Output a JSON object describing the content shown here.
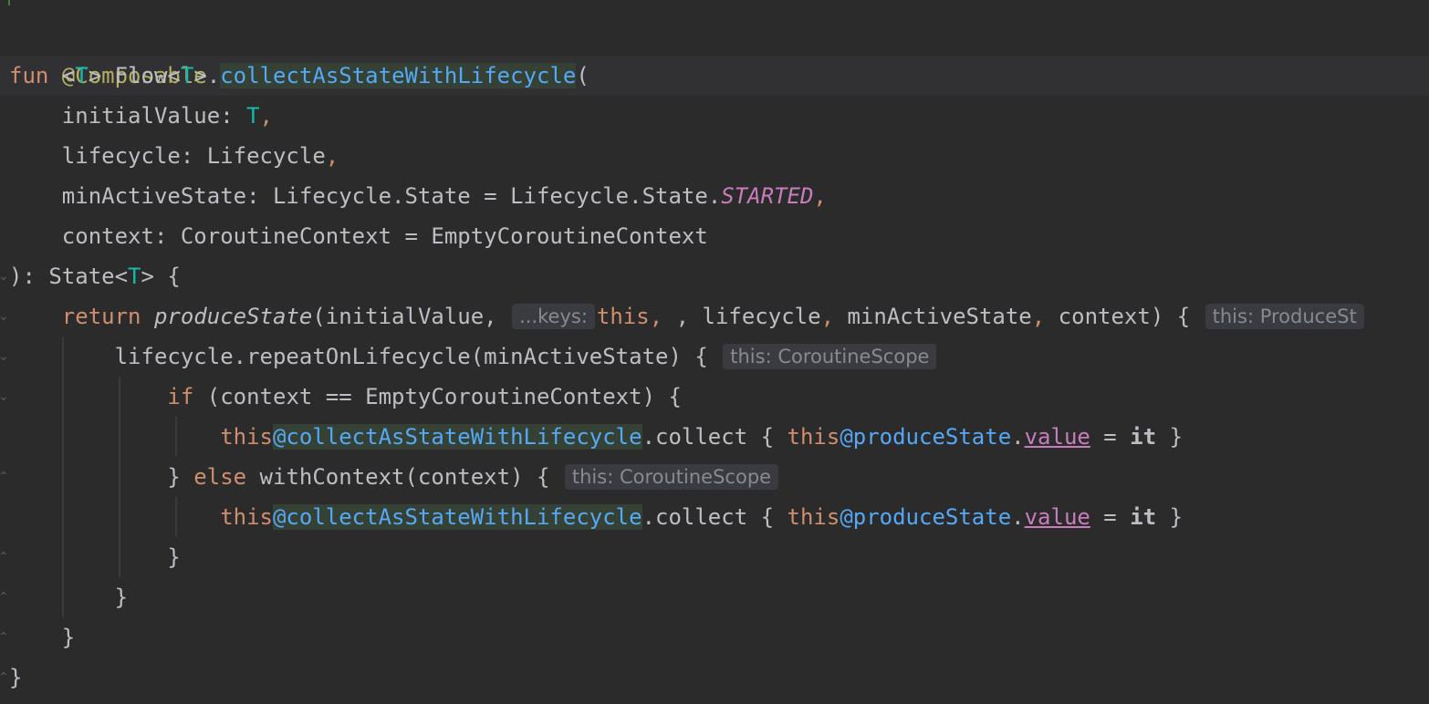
{
  "editor": {
    "language": "Kotlin",
    "lines": {
      "l1": {
        "annotation": "@Composable"
      },
      "l2": {
        "fun_kw": "fun",
        "generic_open": "<",
        "generic_T": "T",
        "generic_close": "> ",
        "receiver": "Flow<",
        "receiver_T": "T",
        "receiver_close": ">.",
        "fn_name": "collectAsStateWithLifecycle",
        "paren": "("
      },
      "l3": {
        "param": "    initialValue: ",
        "type_T": "T",
        "comma": ","
      },
      "l4": {
        "param": "    lifecycle: Lifecycle",
        "comma": ","
      },
      "l5": {
        "param": "    minActiveState: Lifecycle.State = Lifecycle.State.",
        "constant": "STARTED",
        "comma": ","
      },
      "l6": {
        "param": "    context: CoroutineContext = EmptyCoroutineContext"
      },
      "l7": {
        "a": "): State<",
        "T": "T",
        "b": "> {"
      },
      "l8": {
        "indent": "    ",
        "return_kw": "return ",
        "fn": "produceState",
        "args1": "(initialValue, ",
        "hint_keys": "...keys:",
        "this_kw": "this",
        "args2": ", lifecycle",
        "c1": ", ",
        "args3": "minActiveState",
        "c2": ", ",
        "args4": "context) {",
        "hint_receiver": "this: ProduceSt"
      },
      "l9": {
        "indent": "        ",
        "code": "lifecycle.repeatOnLifecycle(minActiveState) {",
        "hint_receiver": "this: CoroutineScope"
      },
      "l10": {
        "indent": "            ",
        "if_kw": "if",
        "code": " (context == EmptyCoroutineContext) {"
      },
      "l11": {
        "indent": "                ",
        "this1": "this",
        "label1": "@collectAsStateWithLifecycle",
        "mid": ".collect { ",
        "this2": "this",
        "label2": "@produceState",
        "dot": ".",
        "value": "value",
        "eq": " = ",
        "it": "it",
        "end": " }"
      },
      "l12": {
        "indent": "            ",
        "brace": "} ",
        "else_kw": "else",
        "code": " withContext(context) {",
        "hint_receiver": "this: CoroutineScope"
      },
      "l13": {
        "indent": "                ",
        "this1": "this",
        "label1": "@collectAsStateWithLifecycle",
        "mid": ".collect { ",
        "this2": "this",
        "label2": "@produceState",
        "dot": ".",
        "value": "value",
        "eq": " = ",
        "it": "it",
        "end": " }"
      },
      "l14": {
        "code": "            }"
      },
      "l15": {
        "code": "        }"
      },
      "l16": {
        "code": "    }"
      },
      "l17": {
        "code": "}"
      }
    }
  },
  "colors": {
    "background": "#2b2b2c",
    "keyword": "#cf8e6d",
    "annotation": "#b3ae60",
    "type_param": "#16baac",
    "function": "#56a8f5",
    "constant": "#c77dbb",
    "identifier_highlight": "#344134",
    "inlay_hint_bg": "#393b40",
    "inlay_hint_fg": "#868a91"
  }
}
